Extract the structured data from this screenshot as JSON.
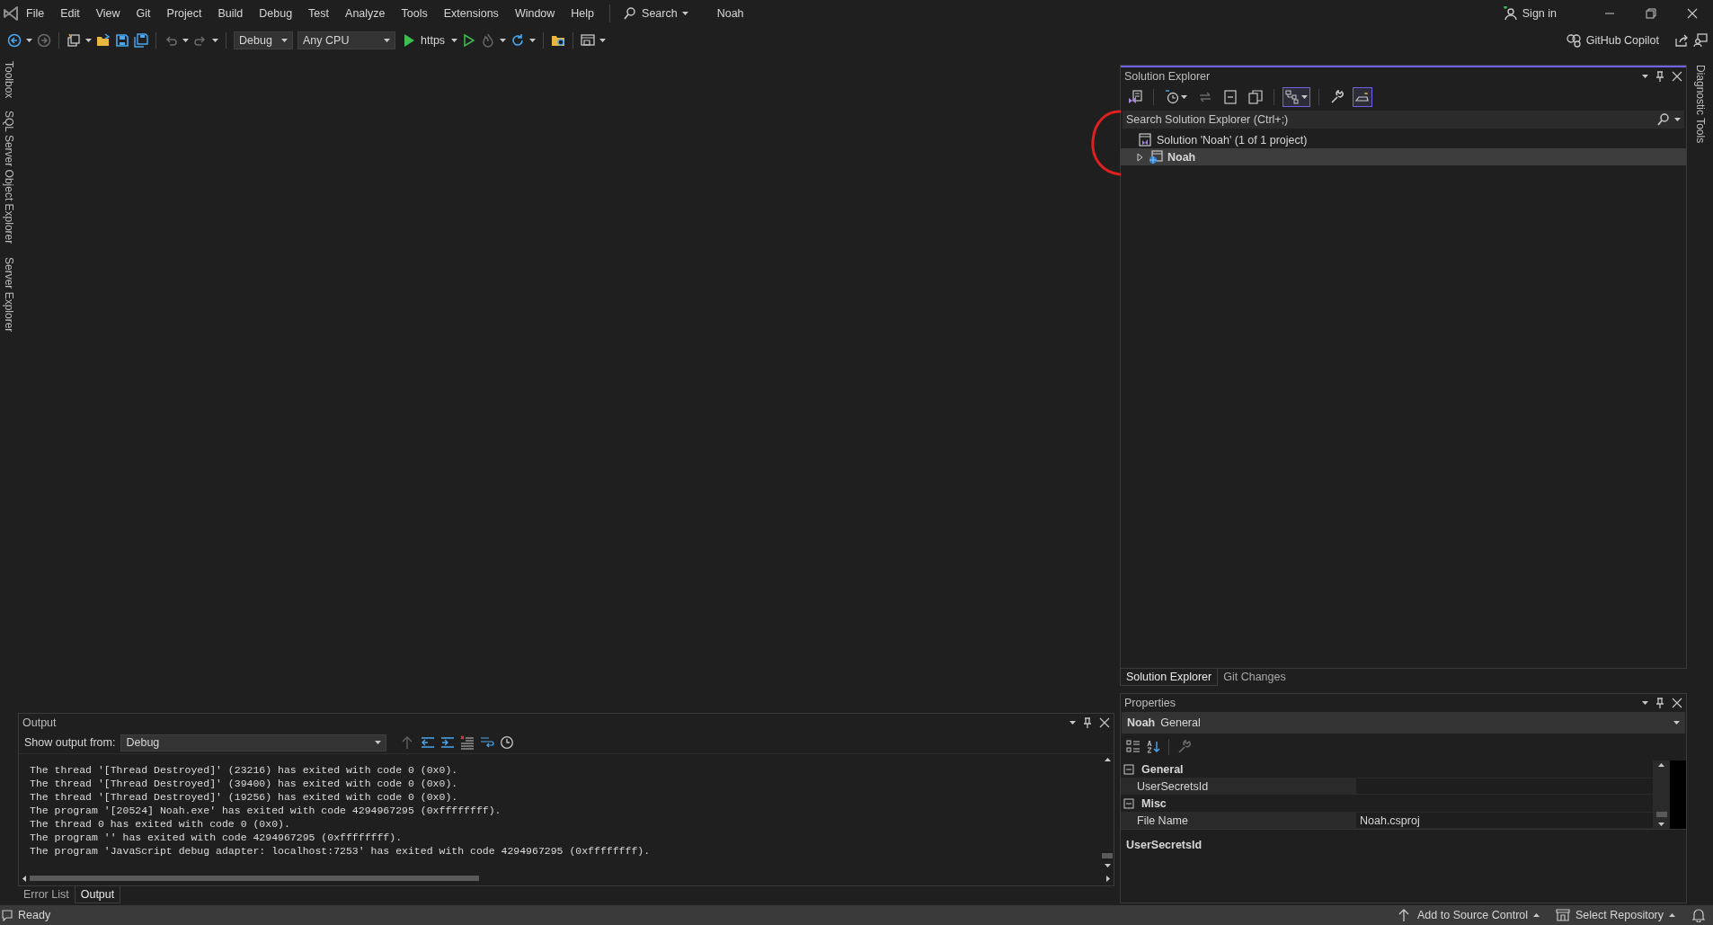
{
  "menu": [
    "File",
    "Edit",
    "View",
    "Git",
    "Project",
    "Build",
    "Debug",
    "Test",
    "Analyze",
    "Tools",
    "Extensions",
    "Window",
    "Help"
  ],
  "search": "Search",
  "solution_name": "Noah",
  "sign_in": "Sign in",
  "toolbar": {
    "configuration": "Debug",
    "platform": "Any CPU",
    "run_target": "https"
  },
  "copilot": "GitHub Copilot",
  "left_tabs": [
    "Toolbox",
    "SQL Server Object Explorer",
    "Server Explorer"
  ],
  "right_tabs": [
    "Diagnostic Tools"
  ],
  "solution_explorer": {
    "title": "Solution Explorer",
    "toolbar": [
      {
        "kind": "home",
        "on": false
      },
      {
        "kind": "history",
        "on": false
      },
      {
        "kind": "sync",
        "on": false
      },
      {
        "kind": "collapse",
        "on": false
      },
      {
        "kind": "show-all",
        "on": false
      },
      {
        "kind": "tree-view",
        "on": true
      },
      {
        "kind": "properties",
        "on": false
      },
      {
        "kind": "preview",
        "on": true
      }
    ],
    "search": {
      "placeholder": "Search Solution Explorer (Ctrl+;)"
    },
    "tree": [
      {
        "label": "Solution 'Noah' (1 of 1 project)",
        "kind": "solution",
        "selected": false,
        "startup": false,
        "children": [
          {
            "label": "Noah",
            "kind": "project",
            "selected": true,
            "startup": true,
            "expanded": false
          }
        ]
      }
    ],
    "tabs": [
      {
        "label": "Solution Explorer",
        "selected": true
      },
      {
        "label": "Git Changes",
        "selected": false
      }
    ]
  },
  "properties": {
    "title": "Properties",
    "object": "Noah",
    "object_type": "General",
    "categories": [
      {
        "label": "General",
        "expanded": true,
        "rows": [
          {
            "name": "UserSecretsId"
          }
        ]
      },
      {
        "label": "Misc",
        "expanded": true,
        "rows": [
          {
            "name": "File Name",
            "value": "Noah.csproj"
          }
        ]
      }
    ],
    "description": "UserSecretsId"
  },
  "output": {
    "title": "Output",
    "show_from_label": "Show output from:",
    "source": "Debug",
    "lines": [
      "The thread '[Thread Destroyed]' (23216) has exited with code 0 (0x0).",
      "The thread '[Thread Destroyed]' (39400) has exited with code 0 (0x0).",
      "The thread '[Thread Destroyed]' (19256) has exited with code 0 (0x0).",
      "The program '[20524] Noah.exe' has exited with code 4294967295 (0xffffffff).",
      "The thread 0 has exited with code 0 (0x0).",
      "The program '' has exited with code 4294967295 (0xffffffff).",
      "The program 'JavaScript debug adapter: localhost:7253' has exited with code 4294967295 (0xffffffff)."
    ],
    "tabs": [
      {
        "label": "Error List",
        "selected": false
      },
      {
        "label": "Output",
        "selected": true
      }
    ]
  },
  "status_bar": {
    "message": "Ready",
    "source_control": "Add to Source Control",
    "repository": "Select Repository"
  }
}
